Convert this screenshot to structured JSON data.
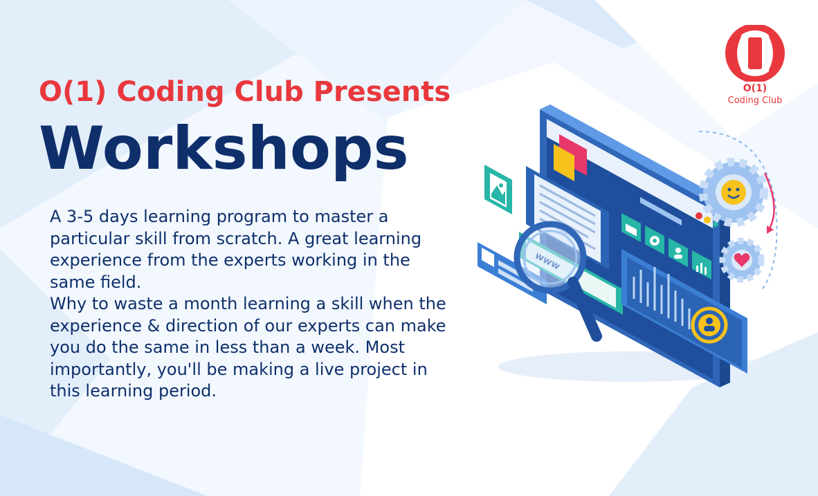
{
  "header": {
    "presents": "O(1) Coding Club Presents",
    "title": "Workshops"
  },
  "description": {
    "paragraph1": "A 3-5 days learning program to master a particular skill from scratch. A great learning experience from the experts working in the same field.",
    "paragraph2": "Why to waste a month learning a skill when the experience & direction of our experts can make you do the same in less than a week. Most importantly, you'll be making a live project in this learning period."
  },
  "logo": {
    "line1": "O(1)",
    "line2": "Coding Club"
  },
  "illustration": {
    "search_text": "www",
    "icons": [
      "image-icon",
      "chat-icon",
      "magnifier-icon",
      "mail-icon",
      "gear-icon",
      "user-icon",
      "bar-chart-icon",
      "smiley-gear-icon",
      "heart-gear-icon",
      "user-badge-icon"
    ]
  },
  "colors": {
    "accent_red": "#e8383d",
    "navy": "#0f2f6b",
    "background": "#f2f8fe",
    "screen_blue": "#3b7fd4",
    "teal": "#27b6a8",
    "yellow": "#f7c21b"
  }
}
